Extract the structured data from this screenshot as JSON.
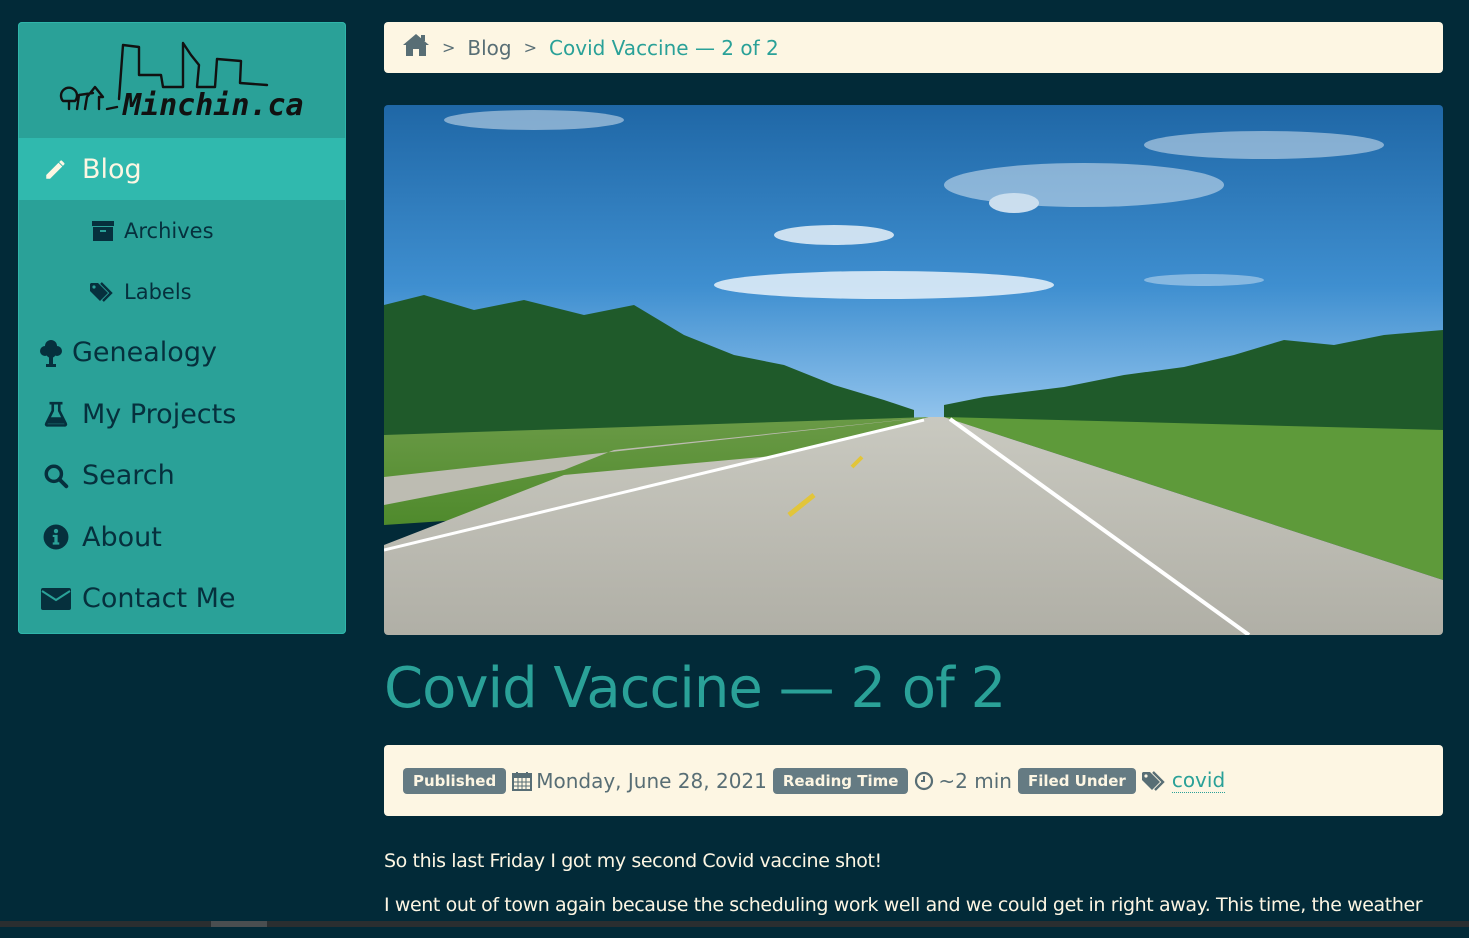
{
  "site": {
    "logo_text": "Minchin.ca"
  },
  "sidebar": {
    "items": [
      {
        "label": "Blog",
        "icon": "pencil-icon",
        "active": true,
        "level": "top"
      },
      {
        "label": "Archives",
        "icon": "archive-box-icon",
        "level": "sub"
      },
      {
        "label": "Labels",
        "icon": "tags-icon",
        "level": "sub"
      },
      {
        "label": "Genealogy",
        "icon": "tree-icon",
        "level": "top"
      },
      {
        "label": "My Projects",
        "icon": "flask-icon",
        "level": "top"
      },
      {
        "label": "Search",
        "icon": "search-icon",
        "level": "top"
      },
      {
        "label": "About",
        "icon": "info-circle-icon",
        "level": "top"
      },
      {
        "label": "Contact Me",
        "icon": "envelope-icon",
        "level": "top"
      }
    ]
  },
  "breadcrumb": {
    "home_icon": "home-icon",
    "separator": ">",
    "items": [
      "Blog",
      "Covid Vaccine — 2 of 2"
    ]
  },
  "hero_image": {
    "alt": "Straight country highway between rows of trees under a blue sky"
  },
  "post": {
    "title": "Covid Vaccine — 2 of 2",
    "meta": {
      "published_label": "Published",
      "published_date": "Monday, June 28, 2021",
      "reading_time_label": "Reading Time",
      "reading_time": "~2 min",
      "filed_under_label": "Filed Under",
      "tag": "covid"
    },
    "paragraphs": [
      "So this last Friday I got my second Covid vaccine shot!",
      "I went out of town again because the scheduling work well and we could get in right away. This time, the weather"
    ]
  },
  "colors": {
    "background": "#022a38",
    "accent": "#2aa198",
    "sidebar_active": "#30b9ae",
    "panel": "#fdf6e3",
    "badge": "#657b83"
  }
}
